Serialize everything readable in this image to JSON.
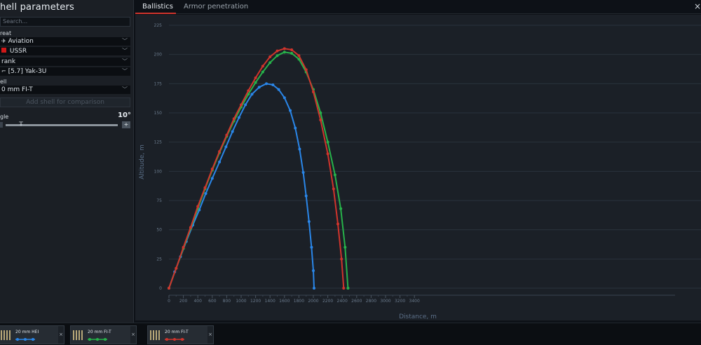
{
  "panel": {
    "title": "hell parameters",
    "search_placeholder": "Search...",
    "threat_label": "reat",
    "threat_value": "Aviation",
    "country_value": "USSR",
    "rank_value": "rank",
    "vehicle_value": "[5.7] Yak-3U",
    "shell_label": "ell",
    "shell_value": "0 mm FI-T",
    "add_shell": "Add shell for comparison",
    "angle_label": "gle",
    "angle_value": "10°",
    "slider_plus": "+",
    "angle_level": 0.12
  },
  "tabs": {
    "ballistics": "Ballistics",
    "armor": "Armor penetration",
    "close": "×"
  },
  "colors": {
    "blue": "#2a86e8",
    "green": "#27b24a",
    "red": "#d0342c"
  },
  "chart_data": {
    "type": "line",
    "xlabel": "Distance, m",
    "ylabel": "Altitude, m",
    "xlim": [
      0,
      5600
    ],
    "ylim": [
      0,
      225
    ],
    "xticks": [
      0,
      200,
      400,
      600,
      800,
      1000,
      1200,
      1400,
      1600,
      1800,
      2000,
      2200,
      2400,
      2600,
      2800,
      3000,
      3200,
      3400
    ],
    "yticks": [
      0,
      25,
      50,
      75,
      100,
      125,
      150,
      175,
      200,
      225
    ],
    "grid": true,
    "series": [
      {
        "color": "#2a86e8",
        "x": [
          0,
          80,
          160,
          240,
          330,
          420,
          510,
          600,
          700,
          790,
          880,
          970,
          1060,
          1150,
          1250,
          1350,
          1440,
          1520,
          1600,
          1680,
          1750,
          1810,
          1860,
          1900,
          1940,
          1975,
          2000,
          2010
        ],
        "y": [
          0,
          14,
          27,
          40,
          54,
          67,
          81,
          94,
          108,
          121,
          134,
          146,
          157,
          166,
          172,
          175,
          174,
          170,
          163,
          152,
          137,
          119,
          99,
          79,
          57,
          35,
          15,
          0
        ]
      },
      {
        "color": "#27b24a",
        "x": [
          0,
          100,
          200,
          300,
          400,
          500,
          600,
          700,
          800,
          900,
          1000,
          1100,
          1200,
          1300,
          1400,
          1500,
          1600,
          1700,
          1800,
          1900,
          2000,
          2100,
          2200,
          2300,
          2380,
          2440,
          2480
        ],
        "y": [
          0,
          17,
          34,
          51,
          68,
          85,
          101,
          116,
          130,
          143,
          155,
          166,
          176,
          185,
          193,
          199,
          202,
          201,
          196,
          185,
          170,
          150,
          125,
          97,
          68,
          35,
          0
        ]
      },
      {
        "color": "#d0342c",
        "x": [
          0,
          100,
          200,
          300,
          400,
          500,
          600,
          700,
          800,
          900,
          1000,
          1100,
          1200,
          1300,
          1400,
          1500,
          1600,
          1700,
          1800,
          1900,
          2000,
          2100,
          2200,
          2280,
          2340,
          2390,
          2420
        ],
        "y": [
          0,
          17,
          35,
          52,
          70,
          86,
          102,
          117,
          131,
          145,
          157,
          169,
          180,
          190,
          198,
          203,
          205,
          204,
          199,
          187,
          168,
          144,
          115,
          85,
          55,
          25,
          0
        ]
      }
    ]
  },
  "bottom": {
    "cards": [
      {
        "name": "20 mm HEI",
        "color": "#2a86e8",
        "close": "×"
      },
      {
        "name": "20 mm FI-T",
        "color": "#27b24a",
        "close": "×"
      },
      {
        "name": "20 mm FI-T",
        "color": "#d0342c",
        "close": "×"
      }
    ]
  }
}
